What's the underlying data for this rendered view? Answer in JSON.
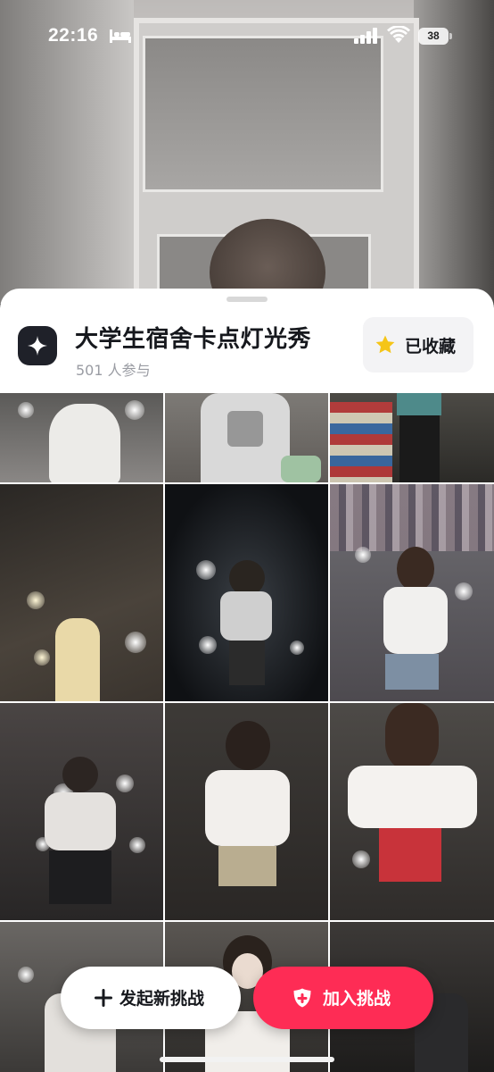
{
  "status_bar": {
    "time": "22:16",
    "battery": "38",
    "icons": [
      "bed-icon",
      "signal-icon",
      "wifi-icon",
      "battery-icon"
    ]
  },
  "challenge": {
    "title": "大学生宿舍卡点灯光秀",
    "participants": "501 人参与",
    "icon": "sparkle-icon",
    "favorite_label": "已收藏",
    "favorite_icon": "star-icon"
  },
  "actions": {
    "start_label": "发起新挑战",
    "join_label": "加入挑战"
  },
  "colors": {
    "accent": "#fe2c55",
    "star": "#f5c518",
    "icon_bg": "#1f2129"
  }
}
